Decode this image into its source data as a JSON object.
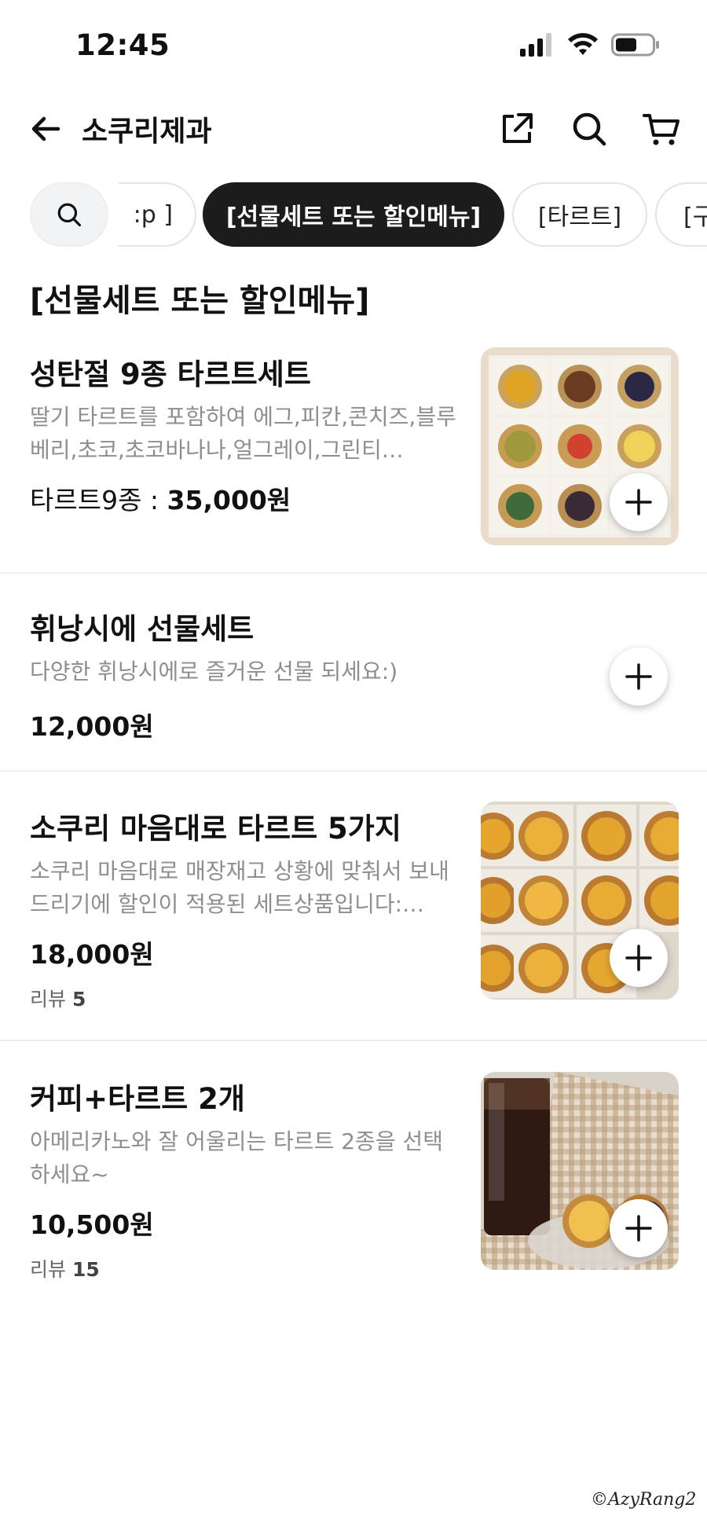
{
  "status_bar": {
    "time": "12:45"
  },
  "header": {
    "title": "소쿠리제과"
  },
  "chips": [
    ":p ]",
    "[선물세트 또는 할인메뉴]",
    "[타르트]",
    "[구"
  ],
  "section_title": "[선물세트 또는 할인메뉴]",
  "items": [
    {
      "name": "성탄절 9종 타르트세트",
      "desc": "딸기 타르트를 포함하여 에그,피칸,콘치즈,블루베리,초코,초코바나나,얼그레이,그린티…",
      "price_label": "타르트9종 : ",
      "price": "35,000원"
    },
    {
      "name": "휘낭시에 선물세트",
      "desc": "다양한 휘낭시에로 즐거운 선물 되세요:)",
      "price": "12,000원"
    },
    {
      "name": "소쿠리 마음대로 타르트 5가지",
      "desc": "소쿠리 마음대로 매장재고 상황에 맞춰서 보내드리기에 할인이 적용된 세트상품입니다:…",
      "price": "18,000원",
      "review_label": "리뷰",
      "review_count": "5"
    },
    {
      "name": "커피+타르트 2개",
      "desc": "아메리카노와 잘 어울리는 타르트 2종을 선택하세요~",
      "price": "10,500원",
      "review_label": "리뷰",
      "review_count": "15"
    }
  ],
  "watermark": "©AzyRang2"
}
